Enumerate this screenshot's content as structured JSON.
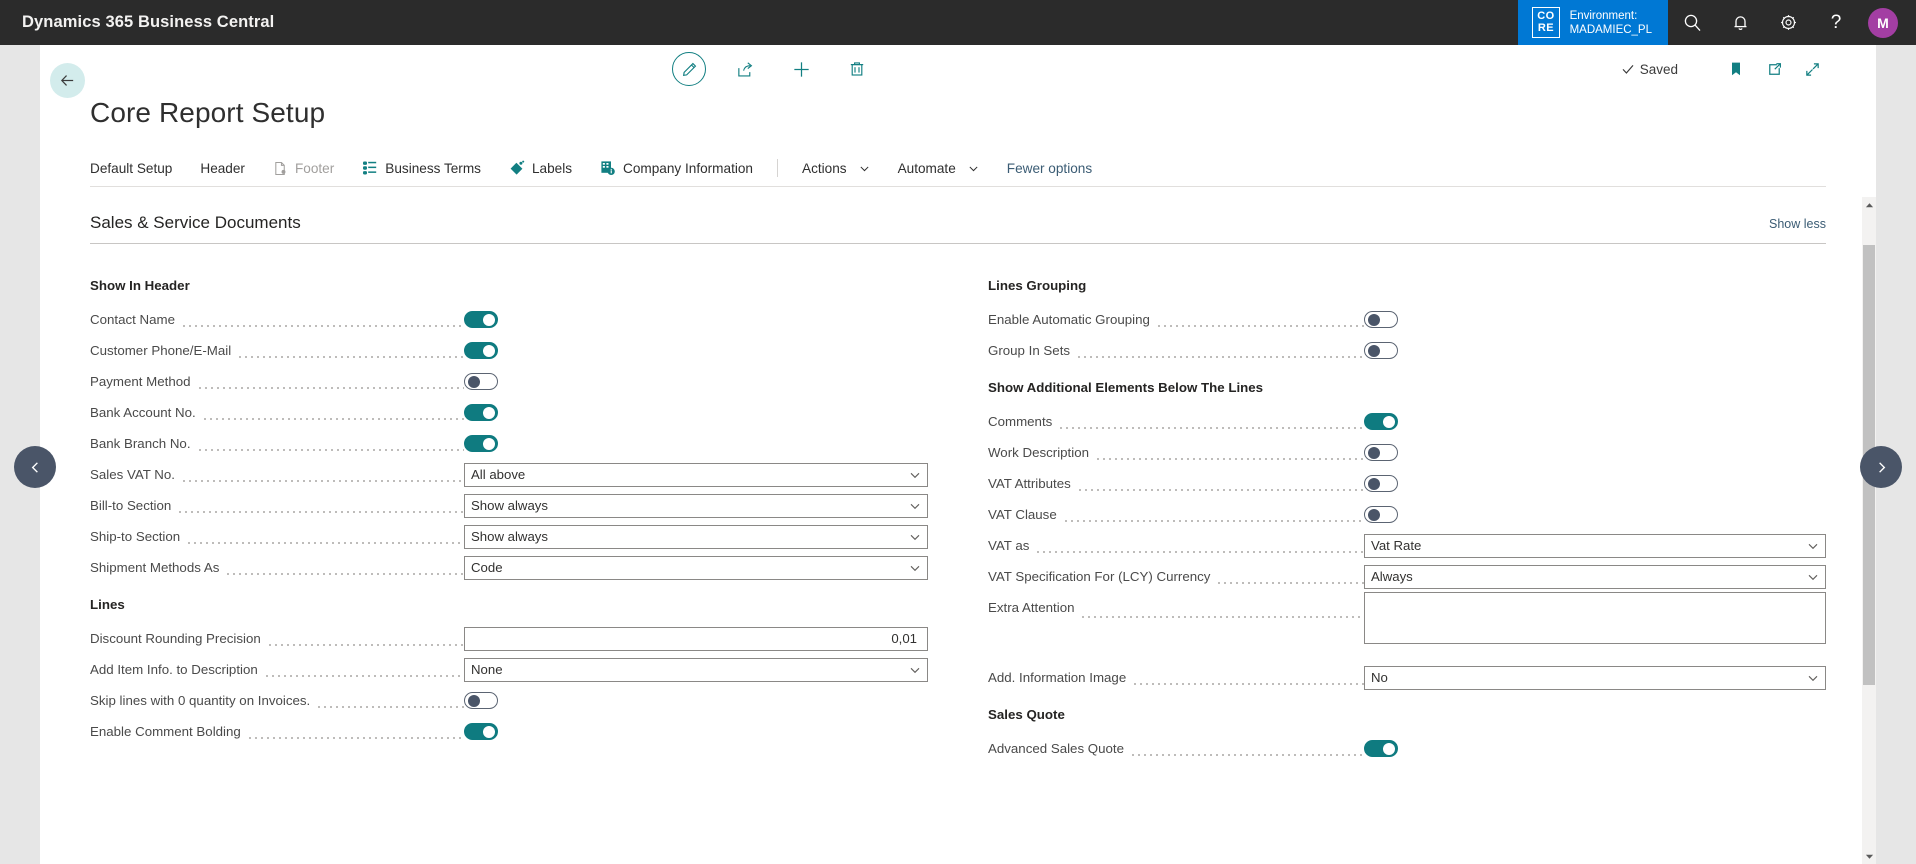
{
  "topbar": {
    "product_title": "Dynamics 365 Business Central",
    "environment": {
      "logo_line1": "CO",
      "logo_line2": "RE",
      "label": "Environment:",
      "name": "MADAMIEC_PL"
    },
    "icons": [
      "search-icon",
      "notification-bell-icon",
      "settings-gear-icon",
      "help-question-icon"
    ],
    "avatar_initial": "M",
    "avatar_color": "#a33ea3",
    "badge_color": "#0078d4",
    "background_color": "#2b2b2b"
  },
  "header": {
    "back_label": "←",
    "page_title": "Core Report Setup",
    "tools": [
      {
        "name": "edit-pencil-icon",
        "label": "Edit"
      },
      {
        "name": "share-icon",
        "label": "Share"
      },
      {
        "name": "add-plus-icon",
        "label": "New"
      },
      {
        "name": "delete-trash-icon",
        "label": "Delete"
      }
    ],
    "status_text": "Saved",
    "right_tools": [
      {
        "name": "bookmark-icon",
        "label": "Bookmark"
      },
      {
        "name": "open-in-new-window-icon",
        "label": "Open in new window"
      },
      {
        "name": "collapse-icon",
        "label": "Collapse"
      }
    ],
    "accent_color": "#127f82"
  },
  "menubar": {
    "items": [
      {
        "label": "Default Setup",
        "icon": null,
        "disabled": false,
        "dropdown": false,
        "link": false
      },
      {
        "label": "Header",
        "icon": null,
        "disabled": false,
        "dropdown": false,
        "link": false
      },
      {
        "label": "Footer",
        "icon": "document-gear-icon",
        "disabled": true,
        "dropdown": false,
        "link": false
      },
      {
        "label": "Business Terms",
        "icon": "business-terms-icon",
        "disabled": false,
        "dropdown": false,
        "link": false
      },
      {
        "label": "Labels",
        "icon": "labels-tag-icon",
        "disabled": false,
        "dropdown": false,
        "link": false
      },
      {
        "label": "Company Information",
        "icon": "company-info-icon",
        "disabled": false,
        "dropdown": false,
        "link": false
      }
    ],
    "actions": [
      {
        "label": "Actions",
        "dropdown": true
      },
      {
        "label": "Automate",
        "dropdown": true
      }
    ],
    "fewer_options": "Fewer options"
  },
  "section": {
    "title": "Sales & Service Documents",
    "show_less": "Show less"
  },
  "left_column": [
    {
      "type": "group",
      "label": "Show In Header"
    },
    {
      "type": "toggle",
      "label": "Contact Name",
      "value": true
    },
    {
      "type": "toggle",
      "label": "Customer Phone/E-Mail",
      "value": true
    },
    {
      "type": "toggle",
      "label": "Payment Method",
      "value": false
    },
    {
      "type": "toggle",
      "label": "Bank Account No.",
      "value": true
    },
    {
      "type": "toggle",
      "label": "Bank Branch No.",
      "value": true
    },
    {
      "type": "select",
      "label": "Sales VAT No.",
      "value": "All above"
    },
    {
      "type": "select",
      "label": "Bill-to Section",
      "value": "Show always"
    },
    {
      "type": "select",
      "label": "Ship-to Section",
      "value": "Show always"
    },
    {
      "type": "select",
      "label": "Shipment Methods As",
      "value": "Code"
    },
    {
      "type": "group",
      "label": "Lines"
    },
    {
      "type": "number",
      "label": "Discount Rounding Precision",
      "value": "0,01"
    },
    {
      "type": "select",
      "label": "Add Item Info. to Description",
      "value": "None"
    },
    {
      "type": "toggle",
      "label": "Skip lines with 0 quantity on Invoices.",
      "value": false
    },
    {
      "type": "toggle",
      "label": "Enable Comment Bolding",
      "value": true
    }
  ],
  "right_column": [
    {
      "type": "group",
      "label": "Lines Grouping"
    },
    {
      "type": "toggle",
      "label": "Enable Automatic Grouping",
      "value": false
    },
    {
      "type": "toggle",
      "label": "Group In Sets",
      "value": false
    },
    {
      "type": "group",
      "label": "Show Additional Elements Below The Lines"
    },
    {
      "type": "toggle",
      "label": "Comments",
      "value": true
    },
    {
      "type": "toggle",
      "label": "Work Description",
      "value": false
    },
    {
      "type": "toggle",
      "label": "VAT Attributes",
      "value": false
    },
    {
      "type": "toggle",
      "label": "VAT Clause",
      "value": false
    },
    {
      "type": "select",
      "label": "VAT as",
      "value": "Vat Rate"
    },
    {
      "type": "select",
      "label": "VAT Specification For (LCY) Currency",
      "value": "Always"
    },
    {
      "type": "textarea",
      "label": "Extra Attention",
      "value": ""
    },
    {
      "type": "select",
      "label": "Add. Information Image",
      "value": "No"
    },
    {
      "type": "group",
      "label": "Sales Quote"
    },
    {
      "type": "toggle",
      "label": "Advanced Sales Quote",
      "value": true
    }
  ],
  "navigation": {
    "previous": "previous-record",
    "next": "next-record"
  },
  "colors": {
    "toggle_on": "#0f7b80",
    "accent_teal": "#127f82",
    "link_blue": "#3b5c74"
  }
}
